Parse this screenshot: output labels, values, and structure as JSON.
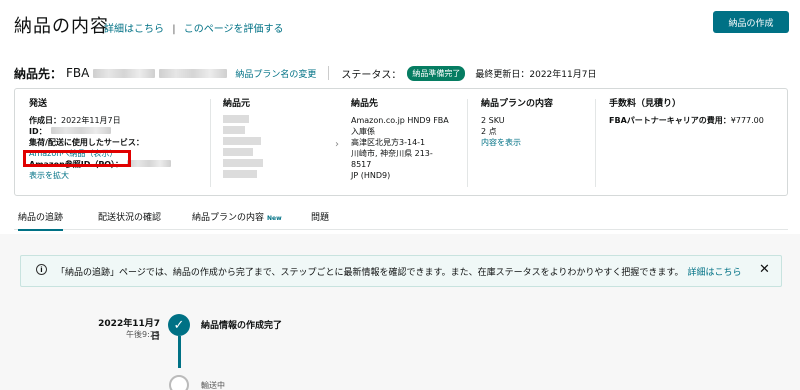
{
  "header": {
    "title": "納品の内容",
    "details_link": "詳細はこちら",
    "separator": "|",
    "rate_link": "このページを評価する",
    "create_button": "納品の作成"
  },
  "shipment_row": {
    "label": "納品先：",
    "name_prefix": "FBA",
    "plan_name_change": "納品プラン名の変更",
    "status_label": "ステータス：",
    "status_badge": "納品準備完了",
    "last_updated": "最終更新日：2022年11月7日"
  },
  "card": {
    "ship": {
      "title": "発送",
      "created_label": "作成日：",
      "created_value": "2022年11月7日",
      "id_label": "ID：",
      "service_label": "集荷/配送に使用したサービス：",
      "amazon_delivery_link": "Amazonへ納品（表示）",
      "ref_label": "Amazon参照ID（PO）：",
      "expand_link": "表示を拡大"
    },
    "origin": {
      "title": "納品元"
    },
    "destination": {
      "title": "納品先",
      "lines": [
        "Amazon.co.jp HND9 FBA",
        "入庫係",
        "高津区北見方3-14-1",
        "川崎市, 神奈川県 213-",
        "8517",
        "JP (HND9)"
      ]
    },
    "plan_contents": {
      "title": "納品プランの内容",
      "sku": "2 SKU",
      "units": "2 点",
      "view_link": "内容を表示"
    },
    "fees": {
      "title": "手数料（見積り）",
      "carrier_label": "FBAパートナーキャリアの費用：",
      "carrier_value": "¥777.00"
    }
  },
  "tabs": [
    {
      "label": "納品の追跡"
    },
    {
      "label": "配送状況の確認"
    },
    {
      "label": "納品プランの内容",
      "tag": "New"
    },
    {
      "label": "問題"
    }
  ],
  "info": {
    "icon": "i",
    "text": "「納品の追跡」ページでは、納品の作成から完了まで、ステップごとに最新情報を確認できます。また、在庫ステータスをよりわかりやすく把握できます。",
    "link": "詳細はこちら",
    "close": "✕"
  },
  "timeline": {
    "step1_date": "2022年11月7日",
    "step1_time": "午後9:25",
    "step1_check": "✓",
    "step1_label": "納品情報の作成完了",
    "step2_label": "輸送中"
  },
  "colors": {
    "accent": "#007185",
    "status_green": "#067d62",
    "highlight_red": "#e00000"
  }
}
